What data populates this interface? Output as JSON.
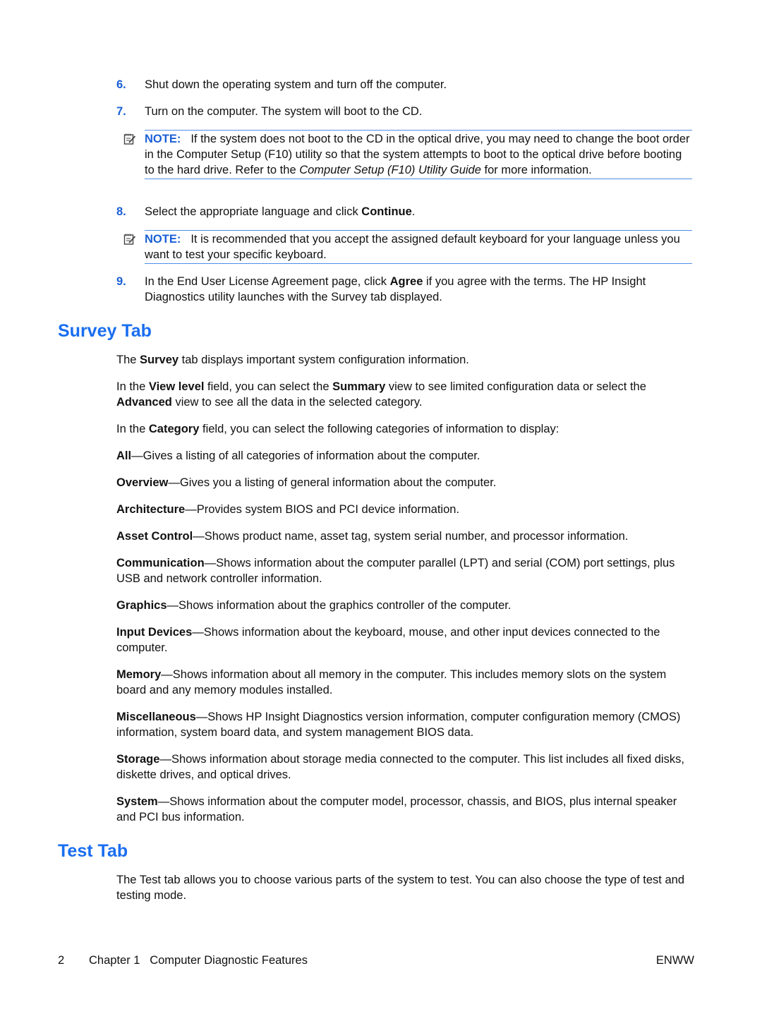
{
  "steps": [
    {
      "num": "6.",
      "text": "Shut down the operating system and turn off the computer."
    },
    {
      "num": "7.",
      "text": "Turn on the computer. The system will boot to the CD."
    },
    {
      "num": "8.",
      "pre": "Select the appropriate language and click ",
      "bold": "Continue",
      "post": "."
    },
    {
      "num": "9.",
      "pre": "In the End User License Agreement page, click ",
      "bold": "Agree",
      "post": " if you agree with the terms. The HP Insight Diagnostics utility launches with the Survey tab displayed."
    }
  ],
  "notes": [
    {
      "icon": "note-pad-icon",
      "label": "NOTE:",
      "pre": "If the system does not boot to the CD in the optical drive, you may need to change the boot order in the Computer Setup (F10) utility so that the system attempts to boot to the optical drive before booting to the hard drive. Refer to the ",
      "italic": "Computer Setup (F10) Utility Guide",
      "post": " for more information."
    },
    {
      "icon": "note-pad-icon",
      "label": "NOTE:",
      "text": "It is recommended that you accept the assigned default keyboard for your language unless you want to test your specific keyboard."
    }
  ],
  "survey": {
    "heading": "Survey Tab",
    "intro": {
      "pre": "The ",
      "bold": "Survey",
      "post": " tab displays important system configuration information."
    },
    "view_level": {
      "p1": "In the ",
      "b1": "View level",
      "p2": " field, you can select the ",
      "b2": "Summary",
      "p3": " view to see limited configuration data or select the ",
      "b3": "Advanced",
      "p4": " view to see all the data in the selected category."
    },
    "category": {
      "pre": "In the ",
      "bold": "Category",
      "post": " field, you can select the following categories of information to display:"
    },
    "categories": [
      {
        "term": "All",
        "desc": "—Gives a listing of all categories of information about the computer."
      },
      {
        "term": "Overview",
        "desc": "—Gives you a listing of general information about the computer."
      },
      {
        "term": "Architecture",
        "desc": "—Provides system BIOS and PCI device information."
      },
      {
        "term": "Asset Control",
        "desc": "—Shows product name, asset tag, system serial number, and processor information."
      },
      {
        "term": "Communication",
        "desc": "—Shows information about the computer parallel (LPT) and serial (COM) port settings, plus USB and network controller information."
      },
      {
        "term": "Graphics",
        "desc": "—Shows information about the graphics controller of the computer."
      },
      {
        "term": "Input Devices",
        "desc": "—Shows information about the keyboard, mouse, and other input devices connected to the computer."
      },
      {
        "term": "Memory",
        "desc": "—Shows information about all memory in the computer. This includes memory slots on the system board and any memory modules installed."
      },
      {
        "term": "Miscellaneous",
        "desc": "—Shows HP Insight Diagnostics version information, computer configuration memory (CMOS) information, system board data, and system management BIOS data."
      },
      {
        "term": "Storage",
        "desc": "—Shows information about storage media connected to the computer. This list includes all fixed disks, diskette drives, and optical drives."
      },
      {
        "term": "System",
        "desc": "—Shows information about the computer model, processor, chassis, and BIOS, plus internal speaker and PCI bus information."
      }
    ]
  },
  "test": {
    "heading": "Test Tab",
    "intro": "The Test tab allows you to choose various parts of the system to test. You can also choose the type of test and testing mode."
  },
  "footer": {
    "page_number": "2",
    "chapter": "Chapter 1   Computer Diagnostic Features",
    "right": "ENWW"
  },
  "colors": {
    "accent": "#1a6ef0",
    "note_rule": "#4f8ee8"
  }
}
